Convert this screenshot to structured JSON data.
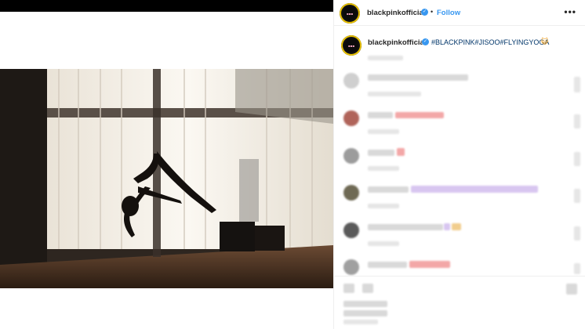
{
  "header": {
    "username": "blackpinkofficial",
    "follow_label": "Follow",
    "separator": "•",
    "more_label": "•••"
  },
  "caption": {
    "username": "blackpinkofficial",
    "text": "#BLACKPINK#JISOO#FLYINGYOGA",
    "emoji": "😺"
  },
  "icons": {
    "verified": "verified-badge-icon",
    "more": "more-options-icon"
  },
  "colors": {
    "accent": "#3897f0",
    "hashtag": "#003569",
    "avatar_ring": "#e8c100"
  }
}
